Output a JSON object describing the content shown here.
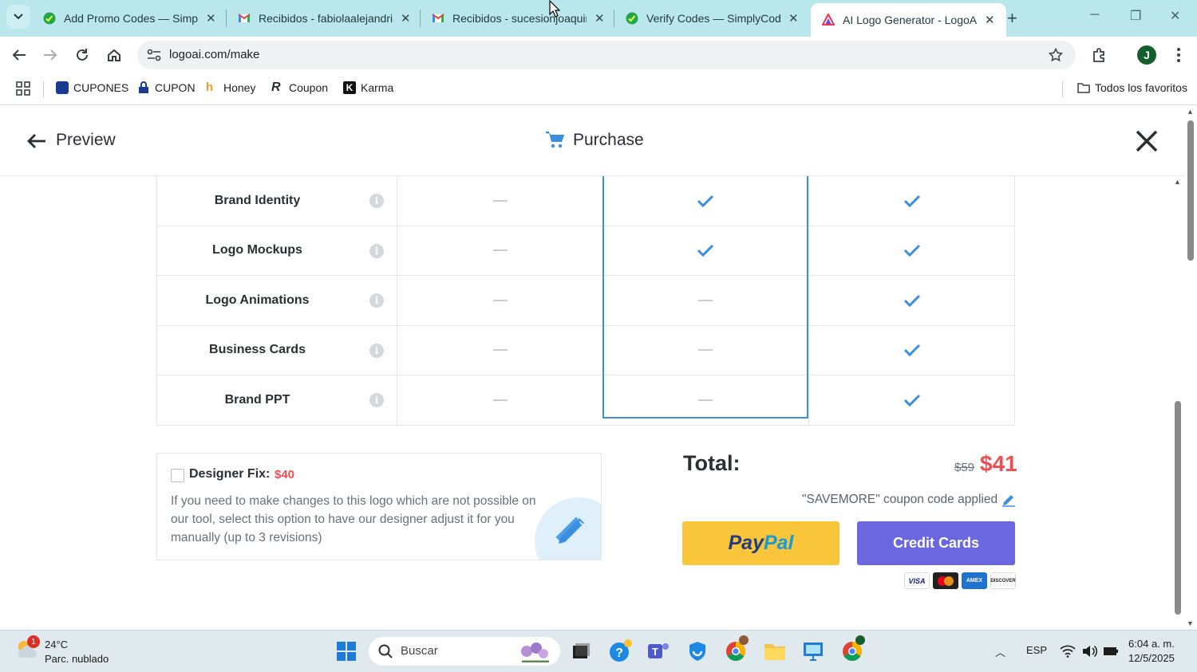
{
  "browser": {
    "tabs": [
      {
        "title": "Add Promo Codes — Simply",
        "favicon": "simplycodes-icon",
        "active": false
      },
      {
        "title": "Recibidos - fabiolaalejandria",
        "favicon": "gmail-icon",
        "active": false
      },
      {
        "title": "Recibidos - sucesionjoaquin",
        "favicon": "gmail-icon",
        "active": false
      },
      {
        "title": "Verify Codes — SimplyCode",
        "favicon": "simplycodes-icon",
        "active": false
      },
      {
        "title": "AI Logo Generator - LogoAI",
        "favicon": "logoai-icon",
        "active": true
      }
    ],
    "url": "logoai.com/make",
    "bookmarks": [
      {
        "label": "CUPONES",
        "icon": "cupones-icon"
      },
      {
        "label": "CUPON",
        "icon": "lock-icon"
      },
      {
        "label": "Honey",
        "icon": "honey-icon"
      },
      {
        "label": "Coupon",
        "icon": "coupon-icon"
      },
      {
        "label": "Karma",
        "icon": "karma-icon"
      }
    ],
    "all_bookmarks": "Todos los favoritos",
    "profile_initial": "J"
  },
  "header": {
    "preview_label": "Preview",
    "purchase_label": "Purchase"
  },
  "features": [
    {
      "name": "Brand Identity",
      "col1": "dash",
      "col2": "check",
      "col3": "check"
    },
    {
      "name": "Logo Mockups",
      "col1": "dash",
      "col2": "check",
      "col3": "check"
    },
    {
      "name": "Logo Animations",
      "col1": "dash",
      "col2": "dash",
      "col3": "check"
    },
    {
      "name": "Business Cards",
      "col1": "dash",
      "col2": "dash",
      "col3": "check"
    },
    {
      "name": "Brand PPT",
      "col1": "dash",
      "col2": "dash",
      "col3": "check"
    }
  ],
  "designer_fix": {
    "label": "Designer Fix:",
    "price": "$40",
    "checked": false,
    "description": "If you need to make changes to this logo which are not possible on our tool, select this option to have our designer adjust it for you manually (up to 3 revisions)"
  },
  "total": {
    "label": "Total:",
    "old_price": "$59",
    "new_price": "$41",
    "coupon_note": "\"SAVEMORE\" coupon code applied"
  },
  "payment": {
    "paypal_pay": "Pay",
    "paypal_pal": "Pal",
    "credit_cards_label": "Credit Cards",
    "cards": [
      "VISA",
      "MC",
      "AMEX",
      "DISCOVER"
    ]
  },
  "taskbar": {
    "weather_badge": "1",
    "temperature": "24°C",
    "condition": "Parc. nublado",
    "search_placeholder": "Buscar",
    "language": "ESP",
    "time": "6:04 a. m.",
    "date": "12/5/2025"
  },
  "colors": {
    "accent_blue": "#3b8fe0",
    "price_red": "#ef4d52",
    "paypal_yellow": "#f9c53a",
    "credit_purple": "#6a67e0",
    "tabstrip": "#b9e7ec"
  }
}
